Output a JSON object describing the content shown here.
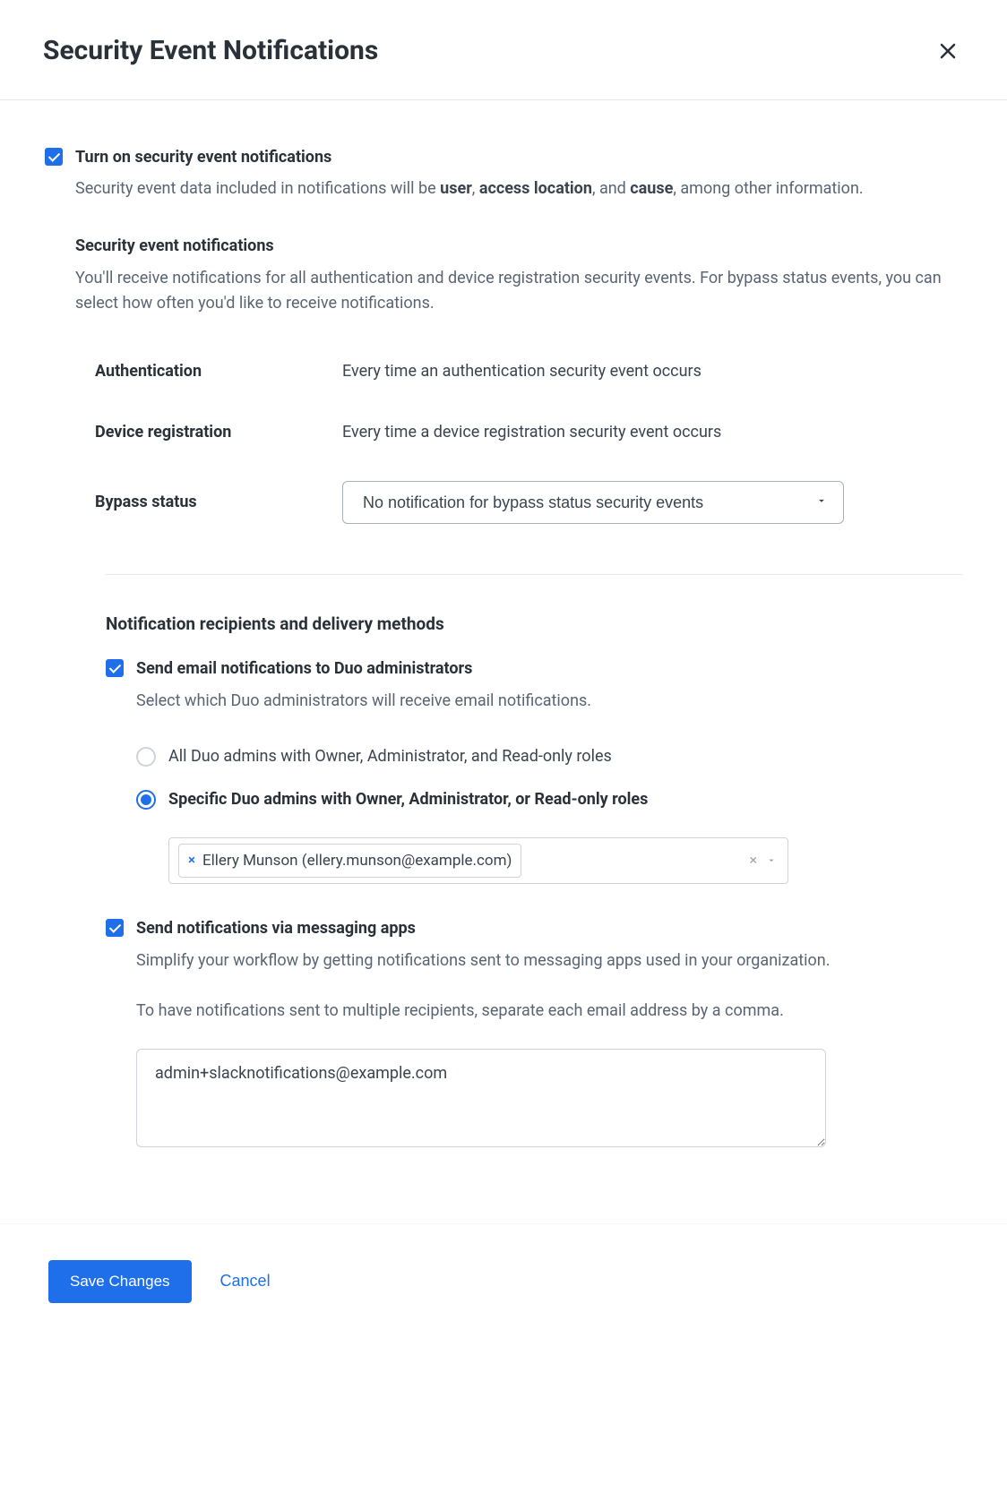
{
  "header": {
    "title": "Security Event Notifications"
  },
  "turn_on": {
    "label": "Turn on security event notifications",
    "desc_prefix": "Security event data included in notifications will be ",
    "desc_bold1": "user",
    "desc_sep1": ", ",
    "desc_bold2": "access location",
    "desc_sep2": ", and ",
    "desc_bold3": "cause",
    "desc_suffix": ", among other information."
  },
  "notifications": {
    "heading": "Security event notifications",
    "desc": "You'll receive notifications for all authentication and device registration security events. For bypass status events, you can select how often you'd like to receive notifications.",
    "rows": {
      "auth_label": "Authentication",
      "auth_value": "Every time an authentication security event occurs",
      "device_label": "Device registration",
      "device_value": "Every time a device registration security event occurs",
      "bypass_label": "Bypass status",
      "bypass_value": "No notification for bypass status security events"
    }
  },
  "recipients": {
    "heading": "Notification recipients and delivery methods",
    "email": {
      "title": "Send email notifications to Duo administrators",
      "desc": "Select which Duo administrators will receive email notifications.",
      "radio_all": "All Duo admins with Owner, Administrator, and Read-only roles",
      "radio_specific": "Specific Duo admins with Owner, Administrator, or Read-only roles",
      "chip": "Ellery Munson (ellery.munson@example.com)"
    },
    "messaging": {
      "title": "Send notifications via messaging apps",
      "desc1": "Simplify your workflow by getting notifications sent to messaging apps used in your organization.",
      "desc2": "To have notifications sent to multiple recipients, separate each email address by a comma.",
      "value": "admin+slacknotifications@example.com"
    }
  },
  "footer": {
    "save": "Save Changes",
    "cancel": "Cancel"
  }
}
